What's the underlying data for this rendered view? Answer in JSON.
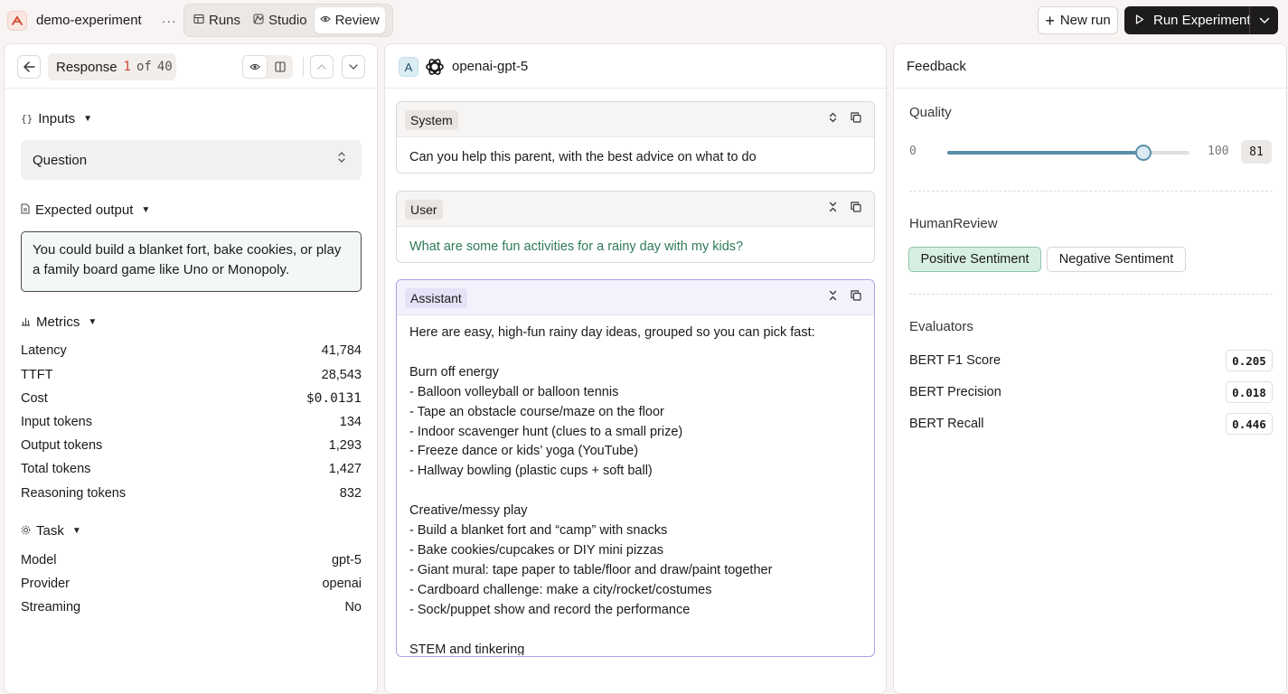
{
  "app": {
    "project_name": "demo-experiment",
    "more": "···"
  },
  "nav": {
    "tabs": [
      {
        "label": "Runs",
        "icon": "table-icon"
      },
      {
        "label": "Studio",
        "icon": "studio-icon"
      },
      {
        "label": "Review",
        "icon": "eye-icon",
        "active": true
      }
    ]
  },
  "actions": {
    "new_run": "New run",
    "run_experiment": "Run Experiment"
  },
  "left": {
    "response_label": "Response",
    "response_index": "1",
    "of_label": "of",
    "response_total": "40",
    "inputs_title": "Inputs",
    "question_select": "Question",
    "expected_title": "Expected output",
    "expected_text": "You could build a blanket fort, bake cookies, or play a family board game like Uno or Monopoly.",
    "metrics_title": "Metrics",
    "metrics": [
      {
        "label": "Latency",
        "value": "41,784"
      },
      {
        "label": "TTFT",
        "value": "28,543"
      },
      {
        "label": "Cost",
        "value": "$0.0131"
      },
      {
        "label": "Input tokens",
        "value": "134"
      },
      {
        "label": "Output tokens",
        "value": "1,293"
      },
      {
        "label": "Total tokens",
        "value": "1,427"
      },
      {
        "label": "Reasoning tokens",
        "value": "832"
      }
    ],
    "task_title": "Task",
    "task": [
      {
        "label": "Model",
        "value": "gpt-5"
      },
      {
        "label": "Provider",
        "value": "openai"
      },
      {
        "label": "Streaming",
        "value": "No"
      }
    ]
  },
  "middle": {
    "badge": "A",
    "model_name": "openai-gpt-5",
    "messages": {
      "system": {
        "role": "System",
        "text": "Can you help this parent, with the best advice on what to do"
      },
      "user": {
        "role": "User",
        "text": "What are some fun activities for a rainy day with my kids?"
      },
      "assistant": {
        "role": "Assistant",
        "text": "Here are easy, high-fun rainy day ideas, grouped so you can pick fast:\n\nBurn off energy\n- Balloon volleyball or balloon tennis\n- Tape an obstacle course/maze on the floor\n- Indoor scavenger hunt (clues to a small prize)\n- Freeze dance or kids’ yoga (YouTube)\n- Hallway bowling (plastic cups + soft ball)\n\nCreative/messy play\n- Build a blanket fort and “camp” with snacks\n- Bake cookies/cupcakes or DIY mini pizzas\n- Giant mural: tape paper to table/floor and draw/paint together\n- Cardboard challenge: make a city/rocket/costumes\n- Sock/puppet show and record the performance\n\nSTEM and tinkering"
      }
    }
  },
  "right": {
    "title": "Feedback",
    "quality_label": "Quality",
    "slider": {
      "min": "0",
      "max": "100",
      "value": "81",
      "fraction": 0.81
    },
    "human_review_label": "HumanReview",
    "positive": "Positive Sentiment",
    "negative": "Negative Sentiment",
    "evaluators_label": "Evaluators",
    "evaluators": [
      {
        "label": "BERT F1 Score",
        "value": "0.205"
      },
      {
        "label": "BERT Precision",
        "value": "0.018"
      },
      {
        "label": "BERT Recall",
        "value": "0.446"
      }
    ]
  }
}
